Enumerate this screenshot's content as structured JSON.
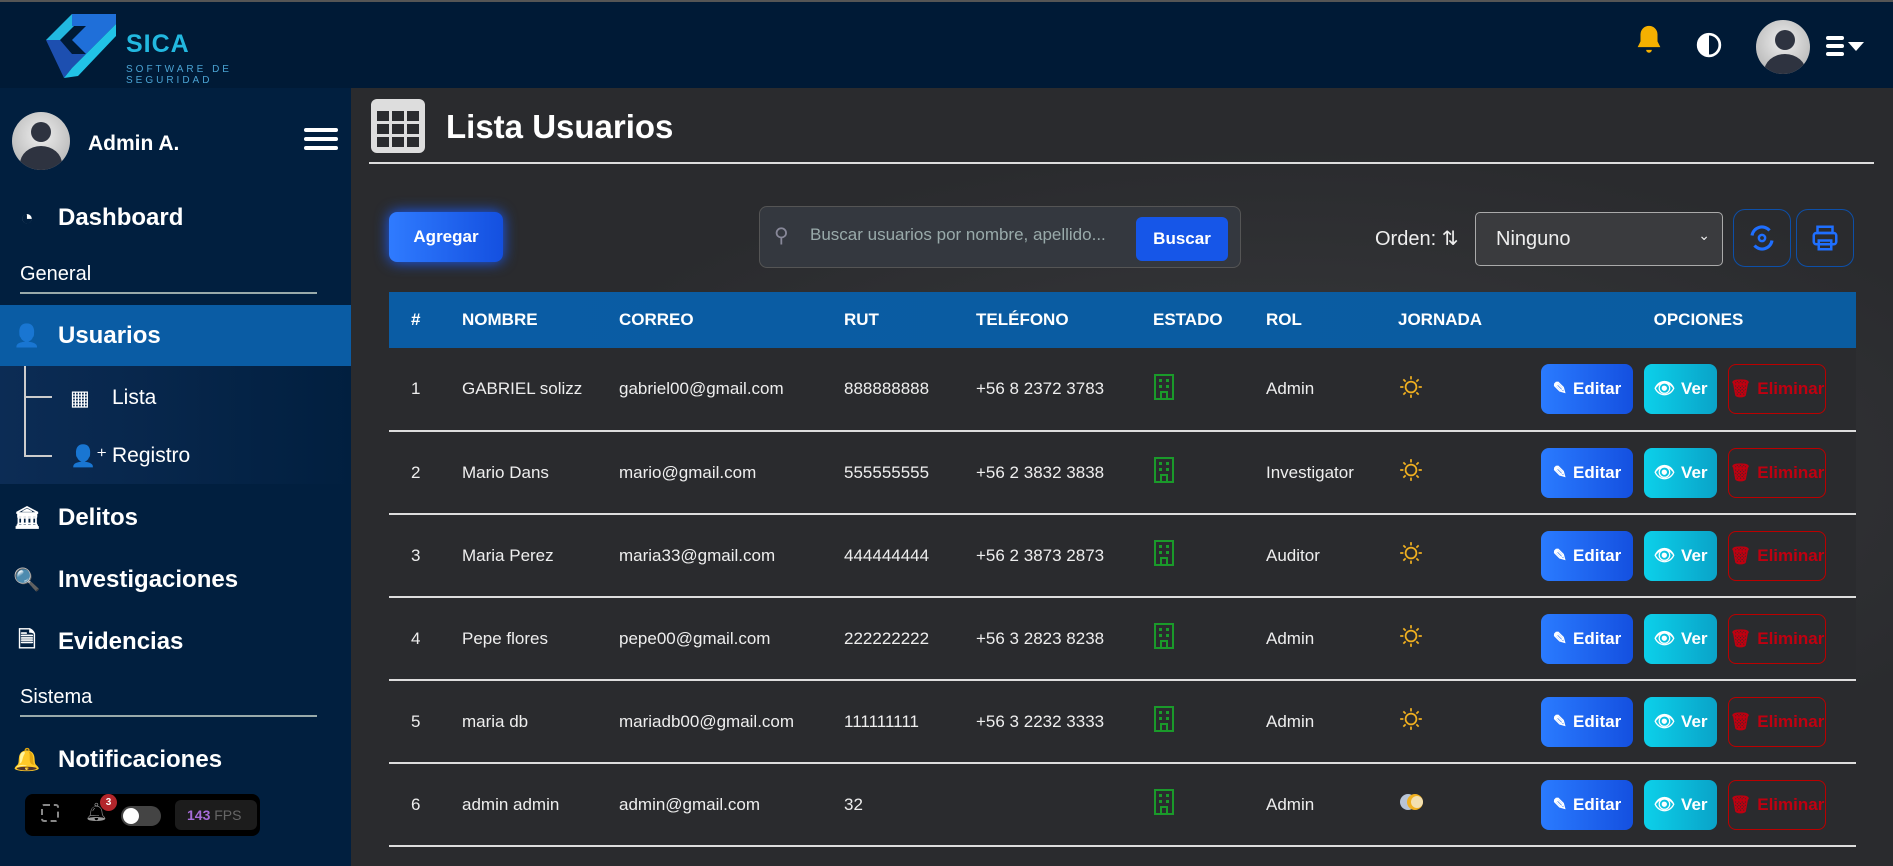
{
  "header": {
    "brand": "SICA",
    "tagline": "SOFTWARE DE SEGURIDAD",
    "icons": [
      "bell-icon",
      "contrast-icon",
      "avatar",
      "menu-caret-icon"
    ]
  },
  "sidebar": {
    "user": "Admin A.",
    "dashboard": "Dashboard",
    "section_general": "General",
    "usuarios": "Usuarios",
    "lista": "Lista",
    "registro": "Registro",
    "delitos": "Delitos",
    "investigaciones": "Investigaciones",
    "evidencias": "Evidencias",
    "section_sistema": "Sistema",
    "notificaciones": "Notificaciones"
  },
  "devtools": {
    "badge": "3",
    "fps": "143",
    "fps_label": "FPS"
  },
  "main": {
    "title": "Lista Usuarios",
    "add": "Agregar",
    "search_placeholder": "Buscar usuarios por nombre, apellido...",
    "search_btn": "Buscar",
    "orden_label": "Orden:",
    "orden_value": "Ninguno"
  },
  "table": {
    "headers": [
      "#",
      "NOMBRE",
      "CORREO",
      "RUT",
      "TELÉFONO",
      "ESTADO",
      "ROL",
      "JORNADA",
      "OPCIONES"
    ],
    "actions": {
      "edit": "Editar",
      "view": "Ver",
      "delete": "Eliminar"
    },
    "rows": [
      {
        "n": "1",
        "nombre": "GABRIEL solizz",
        "correo": "gabriel00@gmail.com",
        "rut": "888888888",
        "tel": "+56 8 2372 3783",
        "rol": "Admin",
        "jornada": "day"
      },
      {
        "n": "2",
        "nombre": "Mario Dans",
        "correo": "mario@gmail.com",
        "rut": "555555555",
        "tel": "+56 2 3832 3838",
        "rol": "Investigator",
        "jornada": "day"
      },
      {
        "n": "3",
        "nombre": "Maria Perez",
        "correo": "maria33@gmail.com",
        "rut": "444444444",
        "tel": "+56 2 3873 2873",
        "rol": "Auditor",
        "jornada": "day"
      },
      {
        "n": "4",
        "nombre": "Pepe flores",
        "correo": "pepe00@gmail.com",
        "rut": "222222222",
        "tel": "+56 3 2823 8238",
        "rol": "Admin",
        "jornada": "day"
      },
      {
        "n": "5",
        "nombre": "maria db",
        "correo": "mariadb00@gmail.com",
        "rut": "111111111",
        "tel": "+56 3 2232 3333",
        "rol": "Admin",
        "jornada": "day"
      },
      {
        "n": "6",
        "nombre": "admin admin",
        "correo": "admin@gmail.com",
        "rut": "32",
        "tel": "",
        "rol": "Admin",
        "jornada": "mixed"
      }
    ]
  }
}
